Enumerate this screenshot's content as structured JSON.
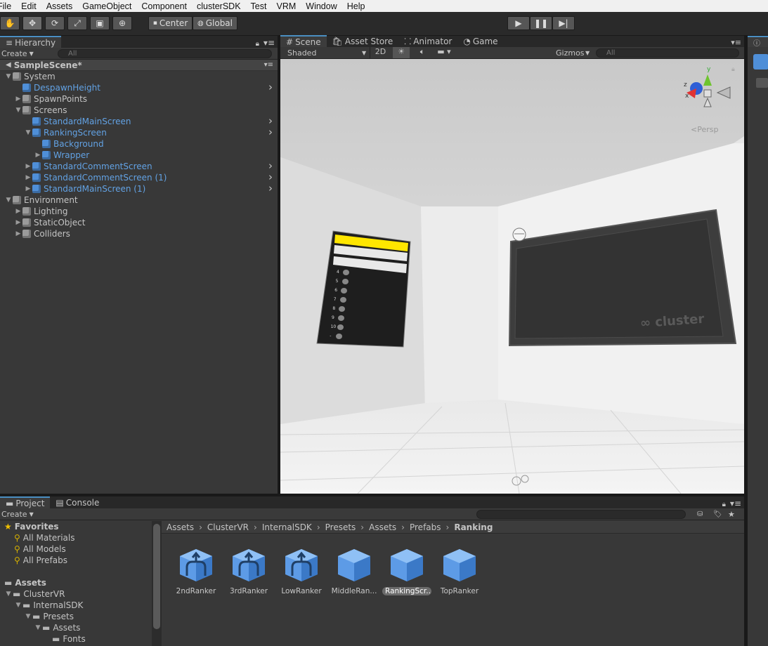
{
  "menu": [
    "File",
    "Edit",
    "Assets",
    "GameObject",
    "Component",
    "clusterSDK",
    "Test",
    "VRM",
    "Window",
    "Help"
  ],
  "toolbar": {
    "center_label": "Center",
    "global_label": "Global"
  },
  "hierarchy": {
    "tab": "Hierarchy",
    "create": "Create",
    "search_placeholder": "All",
    "scene": "SampleScene*",
    "items": [
      {
        "label": "System",
        "depth": 0,
        "arrow": "down",
        "blue": false
      },
      {
        "label": "DespawnHeight",
        "depth": 1,
        "arrow": "",
        "blue": true,
        "chevron": true
      },
      {
        "label": "SpawnPoints",
        "depth": 1,
        "arrow": "right",
        "blue": false
      },
      {
        "label": "Screens",
        "depth": 1,
        "arrow": "down",
        "blue": false
      },
      {
        "label": "StandardMainScreen",
        "depth": 2,
        "arrow": "",
        "blue": true,
        "chevron": true
      },
      {
        "label": "RankingScreen",
        "depth": 2,
        "arrow": "down",
        "blue": true,
        "chevron": true
      },
      {
        "label": "Background",
        "depth": 3,
        "arrow": "",
        "blue": true
      },
      {
        "label": "Wrapper",
        "depth": 3,
        "arrow": "right",
        "blue": true
      },
      {
        "label": "StandardCommentScreen",
        "depth": 2,
        "arrow": "right",
        "blue": true,
        "chevron": true
      },
      {
        "label": "StandardCommentScreen (1)",
        "depth": 2,
        "arrow": "right",
        "blue": true,
        "chevron": true
      },
      {
        "label": "StandardMainScreen (1)",
        "depth": 2,
        "arrow": "right",
        "blue": true,
        "chevron": true
      },
      {
        "label": "Environment",
        "depth": 0,
        "arrow": "down",
        "blue": false
      },
      {
        "label": "Lighting",
        "depth": 1,
        "arrow": "right",
        "blue": false
      },
      {
        "label": "StaticObject",
        "depth": 1,
        "arrow": "right",
        "blue": false
      },
      {
        "label": "Colliders",
        "depth": 1,
        "arrow": "right",
        "blue": false
      }
    ]
  },
  "scene_tabs": {
    "scene": "Scene",
    "asset_store": "Asset Store",
    "animator": "Animator",
    "game": "Game"
  },
  "scene_bar": {
    "shading": "Shaded",
    "mode_2d": "2D",
    "gizmos": "Gizmos",
    "search_placeholder": "All",
    "persp": "Persp",
    "gizmo_y": "y",
    "gizmo_z": "z",
    "gizmo_x": "x"
  },
  "screen_logo": "cluster",
  "ranking": {
    "ranks": [
      "4",
      "5",
      "6",
      "7",
      "8",
      "9",
      "10",
      "-"
    ]
  },
  "project": {
    "tab": "Project",
    "console_tab": "Console",
    "create": "Create",
    "favorites_title": "Favorites",
    "favorites": [
      "All Materials",
      "All Models",
      "All Prefabs"
    ],
    "assets_title": "Assets",
    "tree": [
      {
        "label": "ClusterVR",
        "depth": 1,
        "arrow": "down"
      },
      {
        "label": "InternalSDK",
        "depth": 2,
        "arrow": "down"
      },
      {
        "label": "Presets",
        "depth": 3,
        "arrow": "down"
      },
      {
        "label": "Assets",
        "depth": 4,
        "arrow": "down"
      },
      {
        "label": "Fonts",
        "depth": 5,
        "arrow": ""
      }
    ],
    "breadcrumb": [
      "Assets",
      "ClusterVR",
      "InternalSDK",
      "Presets",
      "Assets",
      "Prefabs",
      "Ranking"
    ],
    "assets": [
      {
        "label": "2ndRanker",
        "variant": true,
        "selected": false
      },
      {
        "label": "3rdRanker",
        "variant": true,
        "selected": false
      },
      {
        "label": "LowRanker",
        "variant": true,
        "selected": false
      },
      {
        "label": "MiddleRan...",
        "variant": false,
        "selected": false
      },
      {
        "label": "RankingScr...",
        "variant": false,
        "selected": true
      },
      {
        "label": "TopRanker",
        "variant": false,
        "selected": false
      }
    ]
  },
  "colors": {
    "accent": "#4a8ec2",
    "prefab_blue": "#62a2e4",
    "panel": "#383838",
    "rank_gold": "#ffe600"
  }
}
